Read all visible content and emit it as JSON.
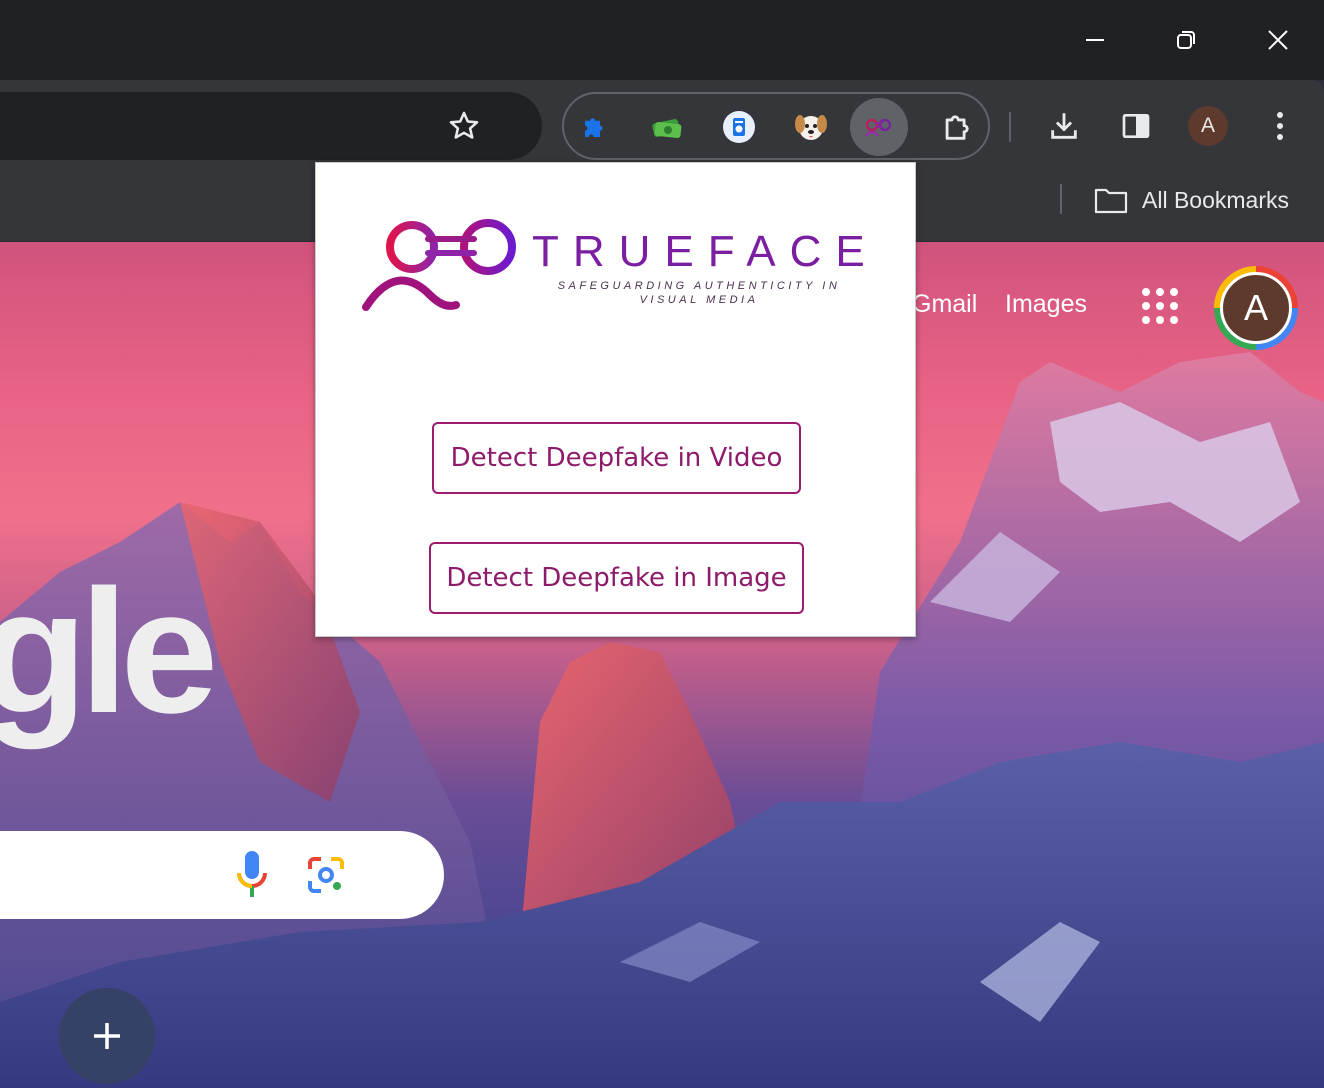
{
  "window": {
    "controls": [
      "minimize-icon",
      "restore-icon",
      "close-icon"
    ]
  },
  "toolbar": {
    "star_icon": "star-outline-icon",
    "extensions": [
      {
        "name": "puzzle-blue-icon",
        "color": "#1a73e8"
      },
      {
        "name": "money-stack-icon",
        "color": "#3a9c3a"
      },
      {
        "name": "document-scan-icon",
        "color": "#1a73e8"
      },
      {
        "name": "dog-face-icon",
        "color": "#c58a4a"
      },
      {
        "name": "trueface-icon",
        "color": "#7b1fa2",
        "active": true
      },
      {
        "name": "extensions-puzzle-icon",
        "color": "#c4c7c5"
      }
    ],
    "avatar_letter": "A"
  },
  "bookmarks": {
    "all_label": "All Bookmarks"
  },
  "ntp": {
    "links": [
      "Gmail",
      "Images"
    ],
    "avatar_letter": "A",
    "logo_fragment": "gle"
  },
  "popup": {
    "brand_name": "TRUEFACE",
    "tagline_line1": "SAFEGUARDING AUTHENTICITY IN",
    "tagline_line2": "VISUAL MEDIA",
    "buttons": {
      "video": "Detect Deepfake in Video",
      "image": "Detect Deepfake in Image"
    },
    "accent_color": "#9c1b6f"
  }
}
